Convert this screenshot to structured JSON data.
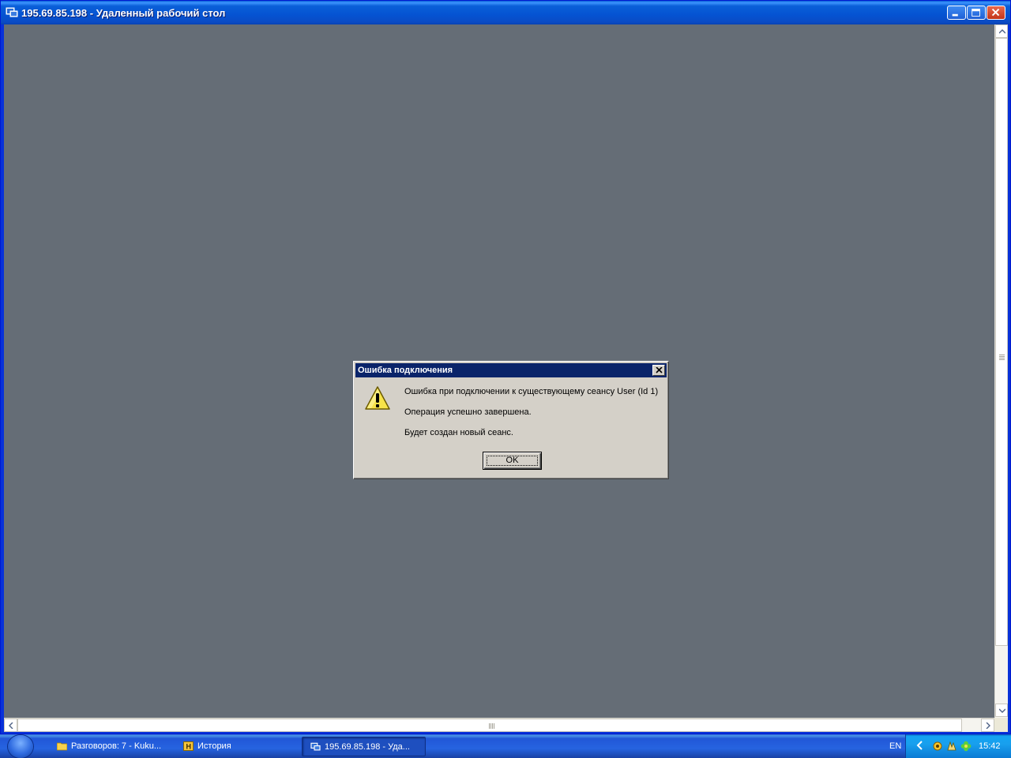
{
  "window": {
    "title": "195.69.85.198 - Удаленный рабочий стол",
    "icon": "remote-desktop-icon",
    "buttons": [
      "minimize",
      "maximize",
      "close"
    ]
  },
  "dialog": {
    "title": "Ошибка подключения",
    "icon": "warning-icon",
    "messages": [
      "Ошибка при подключении к существующему сеансу  User (Id 1)",
      "Операция успешно завершена.",
      "Будет создан новый сеанс."
    ],
    "ok_label": "OK"
  },
  "taskbar": {
    "items": [
      {
        "label": "Разговоров: 7 - Kuku...",
        "icon": "folder-chat-icon"
      },
      {
        "label": "История",
        "icon": "history-icon"
      },
      {
        "label": "195.69.85.198 - Уда...",
        "icon": "remote-desktop-icon",
        "active": true
      }
    ],
    "language": "EN",
    "clock": "15:42",
    "tray_icons": [
      "sun-icon",
      "hand-icon",
      "flower-icon"
    ]
  },
  "colors": {
    "desktop": "#656d76",
    "titlebar": "#0553d2",
    "dialog_title": "#0a246a",
    "dialog_bg": "#d4d0c8"
  }
}
